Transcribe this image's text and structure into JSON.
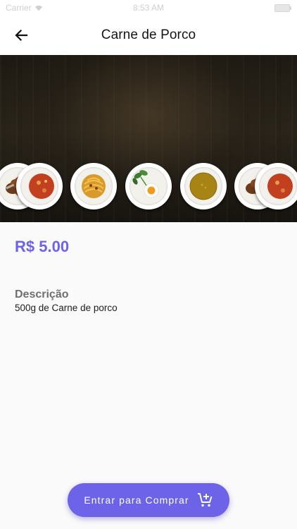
{
  "status_bar": {
    "carrier": "Carrier",
    "time": "8:53 AM"
  },
  "app_bar": {
    "title": "Carne de Porco",
    "back_icon": "arrow-back-icon"
  },
  "product": {
    "price": "R$ 5.00",
    "description_heading": "Descrição",
    "description_text": "500g de Carne de porco"
  },
  "buy_button": {
    "label": "Entrar para Comprar",
    "icon": "add-shopping-cart-icon"
  },
  "colors": {
    "accent": "#6c63e8",
    "background": "#fafafa"
  }
}
